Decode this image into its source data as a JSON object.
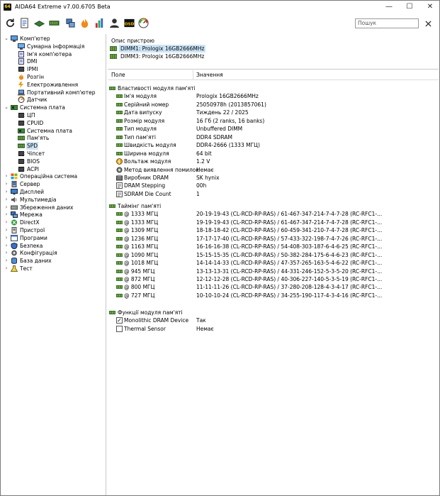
{
  "window": {
    "title": "AIDA64 Extreme v7.00.6705 Beta",
    "app_icon_text": "64",
    "min_glyph": "—",
    "max_glyph": "☐",
    "close_glyph": "✕"
  },
  "toolbar": {
    "search_placeholder": "Пошук",
    "icons": [
      "refresh-icon",
      "report-icon",
      "motherboard-icon",
      "memory-icon",
      "network-icon",
      "flame-icon",
      "bar-chart-icon",
      "user-icon",
      "osd-icon",
      "speedometer-icon"
    ]
  },
  "tree": {
    "computer": "Комп'ютер",
    "computer_children": [
      "Сумарна інформація",
      "Ім'я комп'ютера",
      "DMI",
      "IPMI",
      "Розгін",
      "Електроживлення",
      "Портативний комп'ютер",
      "Датчик"
    ],
    "motherboard": "Системна плата",
    "motherboard_children": [
      "ЦП",
      "CPUID",
      "Системна плата",
      "Пам'ять",
      "SPD",
      "Чіпсет",
      "BIOS",
      "ACPI"
    ],
    "top_level": [
      "Операційна система",
      "Сервер",
      "Дисплей",
      "Мультимедіа",
      "Збереження даних",
      "Мережа",
      "DirectX",
      "Пристрої",
      "Програми",
      "Безпека",
      "Конфігурація",
      "База даних",
      "Тест"
    ],
    "selected": "SPD"
  },
  "device_pane": {
    "header": "Опис пристрою",
    "items": [
      "DIMM1: Prologix 16GB2666MHz",
      "DIMM3: Prologix 16GB2666MHz"
    ],
    "selected_index": 0
  },
  "details": {
    "col_field": "Поле",
    "col_value": "Значення",
    "groups": [
      {
        "title": "Властивості модуля пам'яті",
        "rows": [
          {
            "f": "Ім'я модуля",
            "v": "Prologix 16GB2666MHz"
          },
          {
            "f": "Серійний номер",
            "v": "25050978h (2013857061)"
          },
          {
            "f": "Дата випуску",
            "v": "Тиждень 22 / 2025"
          },
          {
            "f": "Розмір модуля",
            "v": "16 Гб (2 ranks, 16 banks)"
          },
          {
            "f": "Тип модуля",
            "v": "Unbuffered DIMM"
          },
          {
            "f": "Тип пам'яті",
            "v": "DDR4 SDRAM"
          },
          {
            "f": "Швидкість модуля",
            "v": "DDR4-2666 (1333 МГЦ)"
          },
          {
            "f": "Ширина модуля",
            "v": "64 bit"
          },
          {
            "f": "Вольтаж модуля",
            "v": "1.2 V"
          },
          {
            "f": "Метод виявлення помилок",
            "v": "Немає"
          },
          {
            "f": "Виробник DRAM",
            "v": "SK hynix"
          },
          {
            "f": "DRAM Stepping",
            "v": "00h"
          },
          {
            "f": "SDRAM Die Count",
            "v": "1"
          }
        ]
      },
      {
        "title": "Таймінг пам'яті",
        "rows": [
          {
            "f": "@ 1333 МГЦ",
            "v": "20-19-19-43  (CL-RCD-RP-RAS) / 61-467-347-214-7-4-7-28  (RC-RFC1-..."
          },
          {
            "f": "@ 1333 МГЦ",
            "v": "19-19-19-43  (CL-RCD-RP-RAS) / 61-467-347-214-7-4-7-28  (RC-RFC1-..."
          },
          {
            "f": "@ 1309 МГЦ",
            "v": "18-18-18-42  (CL-RCD-RP-RAS) / 60-459-341-210-7-4-7-28  (RC-RFC1-..."
          },
          {
            "f": "@ 1236 МГЦ",
            "v": "17-17-17-40  (CL-RCD-RP-RAS) / 57-433-322-198-7-4-7-26  (RC-RFC1-..."
          },
          {
            "f": "@ 1163 МГЦ",
            "v": "16-16-16-38  (CL-RCD-RP-RAS) / 54-408-303-187-6-4-6-25  (RC-RFC1-..."
          },
          {
            "f": "@ 1090 МГЦ",
            "v": "15-15-15-35  (CL-RCD-RP-RAS) / 50-382-284-175-6-4-6-23  (RC-RFC1-..."
          },
          {
            "f": "@ 1018 МГЦ",
            "v": "14-14-14-33  (CL-RCD-RP-RAS) / 47-357-265-163-5-4-6-22  (RC-RFC1-..."
          },
          {
            "f": "@ 945 МГЦ",
            "v": "13-13-13-31  (CL-RCD-RP-RAS) / 44-331-246-152-5-3-5-20  (RC-RFC1-..."
          },
          {
            "f": "@ 872 МГЦ",
            "v": "12-12-12-28  (CL-RCD-RP-RAS) / 40-306-227-140-5-3-5-19  (RC-RFC1-..."
          },
          {
            "f": "@ 800 МГЦ",
            "v": "11-11-11-26  (CL-RCD-RP-RAS) / 37-280-208-128-4-3-4-17  (RC-RFC1-..."
          },
          {
            "f": "@ 727 МГЦ",
            "v": "10-10-10-24  (CL-RCD-RP-RAS) / 34-255-190-117-4-3-4-16  (RC-RFC1-..."
          }
        ]
      },
      {
        "title": "Функції модуля пам'яті",
        "rows": [
          {
            "f": "Monolithic DRAM Device",
            "v": "Так",
            "checked": true
          },
          {
            "f": "Thermal Sensor",
            "v": "Немає",
            "checked": false
          }
        ]
      }
    ]
  }
}
